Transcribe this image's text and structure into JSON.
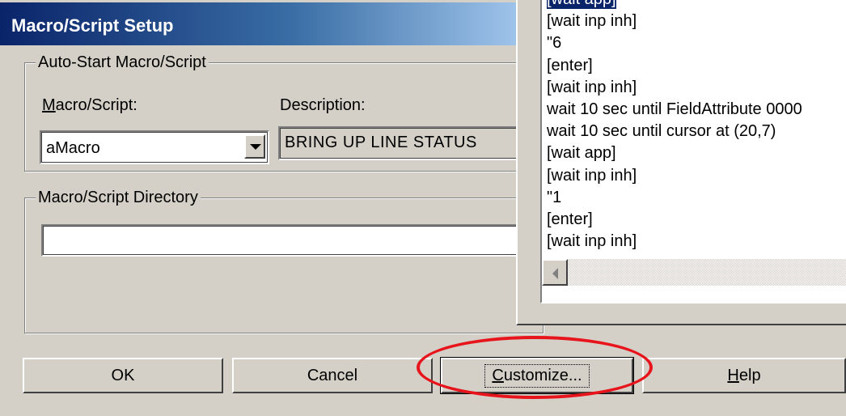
{
  "dialog": {
    "title": "Macro/Script Setup",
    "autostart_group": {
      "label": "Auto-Start Macro/Script",
      "macro_label_u": "M",
      "macro_label_rest": "acro/Script:",
      "description_label": "Description:",
      "macro_value": "aMacro",
      "description_value": "BRING UP LINE STATUS"
    },
    "directory_group": {
      "label": "Macro/Script Directory",
      "directory_value": ""
    },
    "buttons": {
      "ok": "OK",
      "cancel": "Cancel",
      "customize_u": "C",
      "customize_rest": "ustomize...",
      "help_u": "H",
      "help_rest": "elp"
    }
  },
  "script_list": {
    "lines": [
      "[wait app]",
      "[wait inp inh]",
      "\"6",
      "[enter]",
      "[wait inp inh]",
      "wait 10 sec until FieldAttribute 0000",
      "wait 10 sec until cursor at (20,7)",
      "[wait app]",
      "[wait inp inh]",
      "\"1",
      "[enter]",
      "[wait inp inh]"
    ],
    "selected_index": 0
  },
  "annotation": {
    "color": "#e8141c",
    "highlighted": "customize-button"
  },
  "colors": {
    "titlebar_start": "#0a246a",
    "titlebar_end": "#a6caf0",
    "face": "#d4d0c8"
  }
}
